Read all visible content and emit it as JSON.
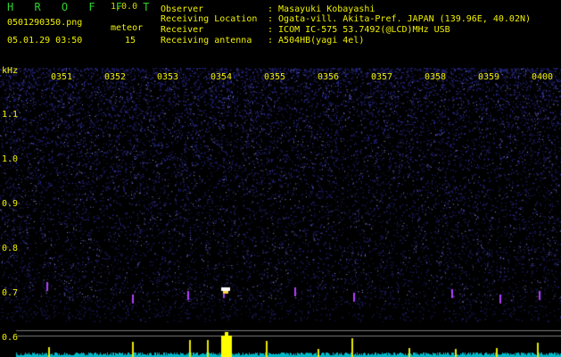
{
  "app": {
    "title": "H R O F F T",
    "version": "1.0.0",
    "filename": "0501290350.png",
    "datetime": "05.01.29 03:50",
    "meteor_label": "meteor",
    "meteor_count": "15"
  },
  "info": [
    {
      "key": "Observer",
      "value": ": Masayuki Kobayashi"
    },
    {
      "key": "Receiving Location",
      "value": ": Ogata-vill. Akita-Pref. JAPAN (139.96E, 40.02N)"
    },
    {
      "key": "Receiver",
      "value": ": ICOM IC-575 53.7492(@LCD)MHz USB"
    },
    {
      "key": "Receiving antenna",
      "value": ": A504HB(yagi 4el)"
    }
  ],
  "axis": {
    "y_unit": "kHz",
    "y_ticks": [
      "1.1",
      "1.0",
      "0.9",
      "0.8",
      "0.7",
      "0.6"
    ],
    "x_ticks": [
      "0351",
      "0352",
      "0353",
      "0354",
      "0355",
      "0356",
      "0357",
      "0358",
      "0359",
      "0400"
    ]
  },
  "colors": {
    "background": "#000000",
    "noise": "#2a2a9a",
    "label": "#f0f000",
    "title_green": "#2ed12e",
    "echo": "#ffff00",
    "baseline": "#00c8d0"
  }
}
